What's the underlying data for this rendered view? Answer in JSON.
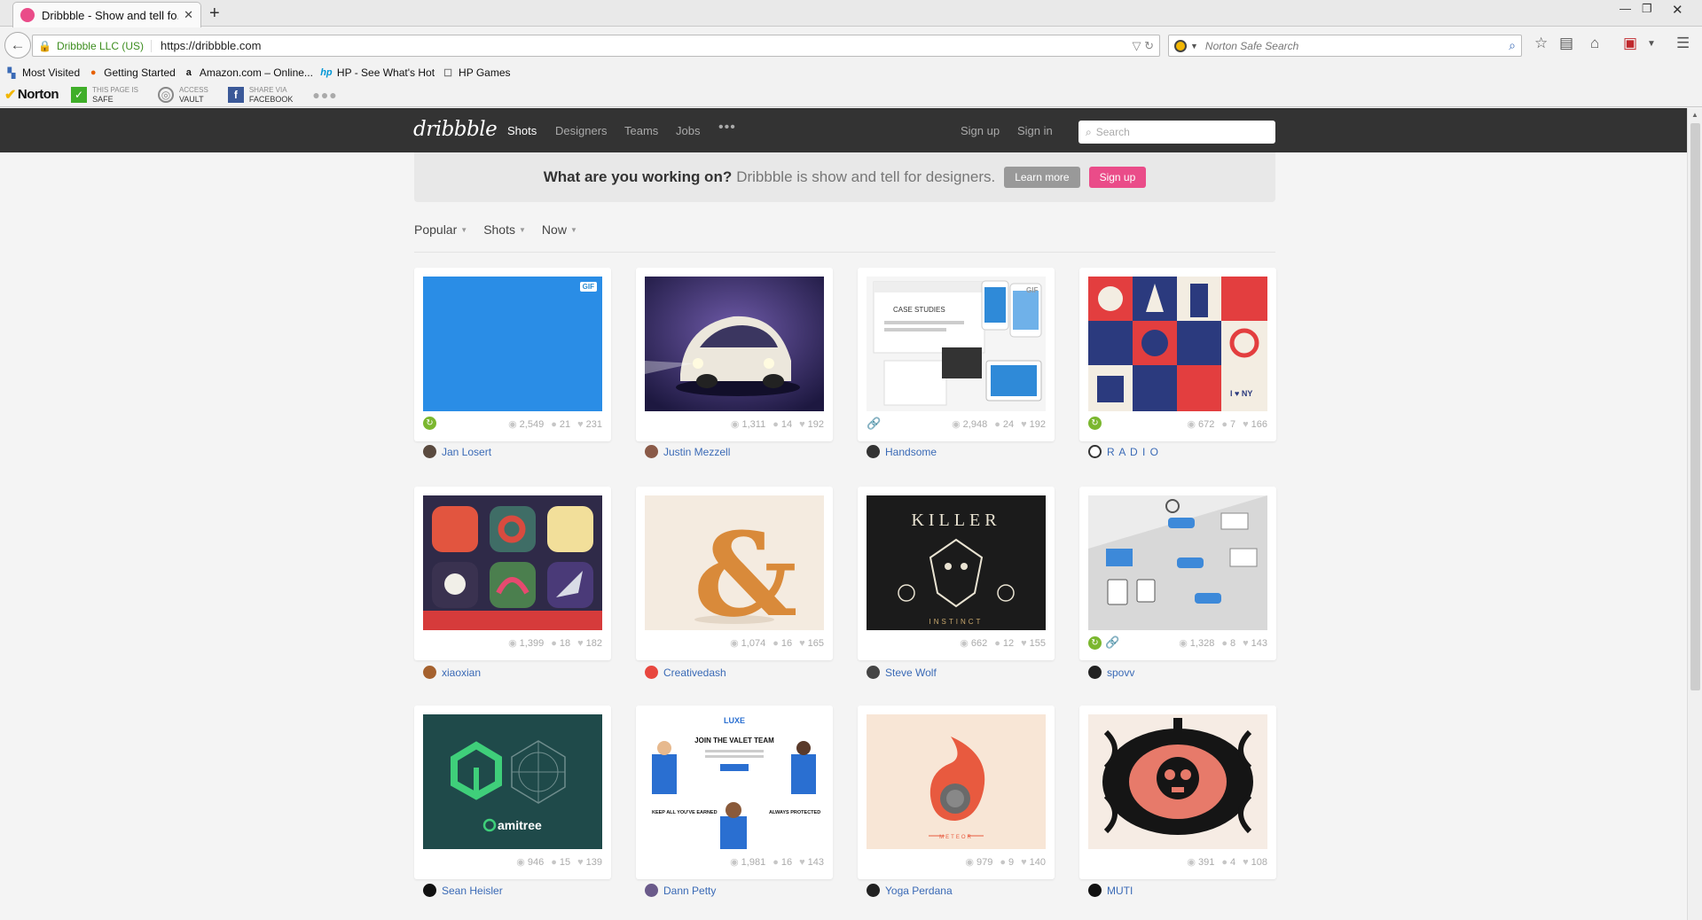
{
  "browser": {
    "tab_title": "Dribbble - Show and tell fo...",
    "tab_close": "✕",
    "new_tab": "+",
    "site_identity": "Dribbble LLC (US)",
    "url": "https://dribbble.com",
    "search_placeholder": "Norton Safe Search",
    "bookmarks": [
      {
        "label": "Most Visited",
        "icon": "star-icon"
      },
      {
        "label": "Getting Started",
        "icon": "firefox-icon"
      },
      {
        "label": "Amazon.com – Online...",
        "icon": "amazon-icon"
      },
      {
        "label": "HP - See What's Hot",
        "icon": "hp-icon"
      },
      {
        "label": "HP Games",
        "icon": "page-icon"
      }
    ],
    "norton": {
      "brand": "Norton",
      "safe_l1": "THIS PAGE IS",
      "safe_l2": "SAFE",
      "vault_l1": "ACCESS",
      "vault_l2": "VAULT",
      "share_l1": "SHARE VIA",
      "share_l2": "FACEBOOK"
    }
  },
  "site": {
    "logo": "dribbble",
    "nav": [
      "Shots",
      "Designers",
      "Teams",
      "Jobs"
    ],
    "nav_more": "•••",
    "signup": "Sign up",
    "signin": "Sign in",
    "search_placeholder": "Search",
    "accent": "#ea4c89",
    "link_color": "#3a6ab6"
  },
  "banner": {
    "question": "What are you working on?",
    "description": "Dribbble is show and tell for designers.",
    "learn_more": "Learn more",
    "signup": "Sign up"
  },
  "filters": [
    "Popular",
    "Shots",
    "Now"
  ],
  "shots": [
    {
      "author": "Jan Losert",
      "views": "2,549",
      "comments": "21",
      "likes": "231",
      "gif": "GIF",
      "rebound": true,
      "link": false
    },
    {
      "author": "Justin Mezzell",
      "views": "1,311",
      "comments": "14",
      "likes": "192",
      "rebound": false,
      "link": false
    },
    {
      "author": "Handsome",
      "views": "2,948",
      "comments": "24",
      "likes": "192",
      "gif": "GIF",
      "rebound": false,
      "link": true,
      "thumb_text": "CASE STUDIES"
    },
    {
      "author": "R A D I O",
      "views": "672",
      "comments": "7",
      "likes": "166",
      "rebound": true,
      "link": false,
      "thumb_text": "I ♥ NY"
    },
    {
      "author": "xiaoxian",
      "views": "1,399",
      "comments": "18",
      "likes": "182",
      "rebound": false,
      "link": false
    },
    {
      "author": "Creativedash",
      "views": "1,074",
      "comments": "16",
      "likes": "165",
      "rebound": false,
      "link": false
    },
    {
      "author": "Steve Wolf",
      "views": "662",
      "comments": "12",
      "likes": "155",
      "rebound": false,
      "link": false,
      "thumb_text": "KILLER",
      "thumb_sub": "INSTINCT"
    },
    {
      "author": "spovv",
      "views": "1,328",
      "comments": "8",
      "likes": "143",
      "rebound": true,
      "link": true
    },
    {
      "author": "Sean Heisler",
      "views": "946",
      "comments": "15",
      "likes": "139",
      "rebound": false,
      "link": false,
      "thumb_text": "amitree"
    },
    {
      "author": "Dann Petty",
      "views": "1,981",
      "comments": "16",
      "likes": "143",
      "rebound": false,
      "link": false,
      "thumb_text": "JOIN THE VALET TEAM",
      "thumb_brand": "LUXE",
      "thumb_left": "KEEP ALL YOU'VE EARNED",
      "thumb_right": "ALWAYS PROTECTED"
    },
    {
      "author": "Yoga Perdana",
      "views": "979",
      "comments": "9",
      "likes": "140",
      "rebound": false,
      "link": false,
      "thumb_text": "METEOR"
    },
    {
      "author": "MUTI",
      "views": "391",
      "comments": "4",
      "likes": "108",
      "rebound": false,
      "link": false
    }
  ]
}
